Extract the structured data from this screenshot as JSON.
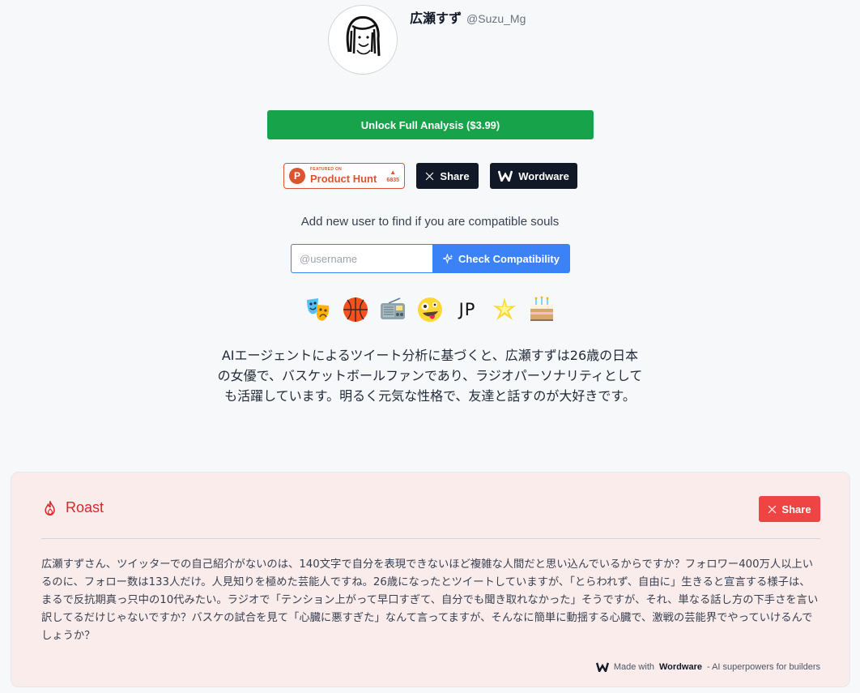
{
  "profile": {
    "display_name": "広瀬すず",
    "handle": "@Suzu_Mg"
  },
  "actions": {
    "unlock_label": "Unlock Full Analysis ($3.99)",
    "share_label": "Share",
    "wordware_label": "Wordware"
  },
  "product_hunt": {
    "featured_label": "FEATURED ON",
    "name": "Product Hunt",
    "votes": "6835",
    "logo_letter": "P"
  },
  "compatibility": {
    "prompt": "Add new user to find if you are compatible souls",
    "input_placeholder": "@username",
    "button_label": "Check Compatibility"
  },
  "emojis": [
    {
      "icon": "performing-arts-icon"
    },
    {
      "icon": "basketball-icon"
    },
    {
      "icon": "radio-icon"
    },
    {
      "icon": "zany-face-icon"
    },
    {
      "text": "JP"
    },
    {
      "icon": "sparkle-star-icon"
    },
    {
      "icon": "birthday-cake-icon"
    }
  ],
  "summary": "AIエージェントによるツイート分析に基づくと、広瀬すずは26歳の日本の女優で、バスケットボールファンであり、ラジオパーソナリティとしても活躍しています。明るく元気な性格で、友達と話すのが大好きです。",
  "roast": {
    "title": "Roast",
    "share_label": "Share",
    "body": "広瀬すずさん、ツイッターでの自己紹介がないのは、140文字で自分を表現できないほど複雑な人間だと思い込んでいるからですか？フォロワー400万人以上いるのに、フォロー数は133人だけ。人見知りを極めた芸能人ですね。26歳になったとツイートしていますが、「とらわれず、自由に」生きると宣言する様子は、まるで反抗期真っ只中の10代みたい。ラジオで「テンション上がって早口すぎて、自分でも聞き取れなかった」そうですが、それ、単なる話し方の下手さを言い訳してるだけじゃないですか？バスケの試合を見て「心臓に悪すぎた」なんて言ってますが、そんなに簡単に動揺する心臓で、激戦の芸能界でやっていけるんでしょうか？",
    "footer_prefix": "Made with",
    "footer_brand": "Wordware",
    "footer_suffix": "- AI superpowers for builders"
  },
  "colors": {
    "unlock": "#16a34a",
    "compat": "#3b82f6",
    "roast_accent": "#dc2626",
    "roast_bg": "#fbecec",
    "product_hunt": "#da552f",
    "dark": "#111827"
  }
}
